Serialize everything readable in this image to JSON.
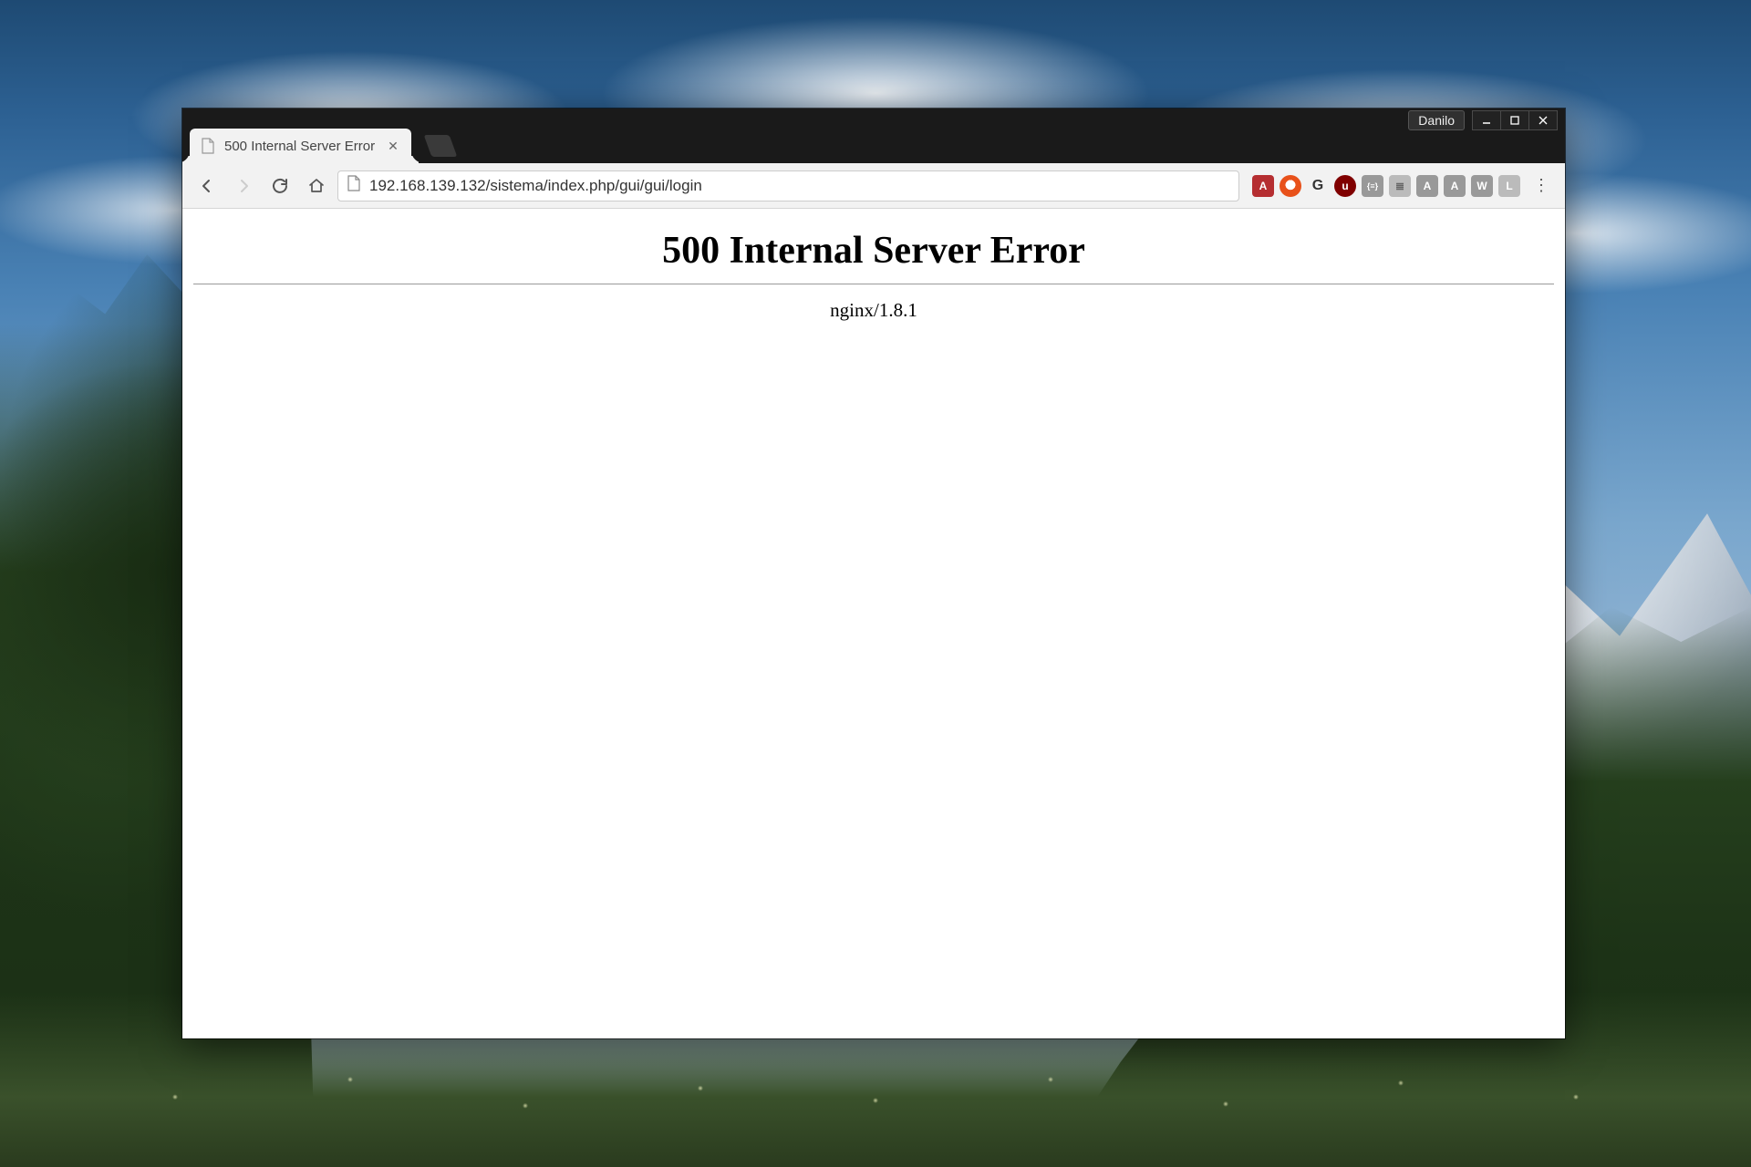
{
  "window": {
    "user_badge": "Danilo"
  },
  "tab": {
    "title": "500 Internal Server Error"
  },
  "address_bar": {
    "url": "192.168.139.132/sistema/index.php/gui/gui/login"
  },
  "extensions": [
    {
      "name": "angular-icon",
      "label": "A"
    },
    {
      "name": "brave-icon",
      "label": ""
    },
    {
      "name": "grammarly-icon",
      "label": "G"
    },
    {
      "name": "ublock-icon",
      "label": "u"
    },
    {
      "name": "braces-icon",
      "label": "{≡}"
    },
    {
      "name": "server-icon",
      "label": "≣"
    },
    {
      "name": "angular-devtools-icon",
      "label": "A"
    },
    {
      "name": "a-extension-icon",
      "label": "A"
    },
    {
      "name": "w-extension-icon",
      "label": "W"
    },
    {
      "name": "l-extension-icon",
      "label": "L"
    }
  ],
  "page": {
    "heading": "500 Internal Server Error",
    "server_line": "nginx/1.8.1"
  }
}
